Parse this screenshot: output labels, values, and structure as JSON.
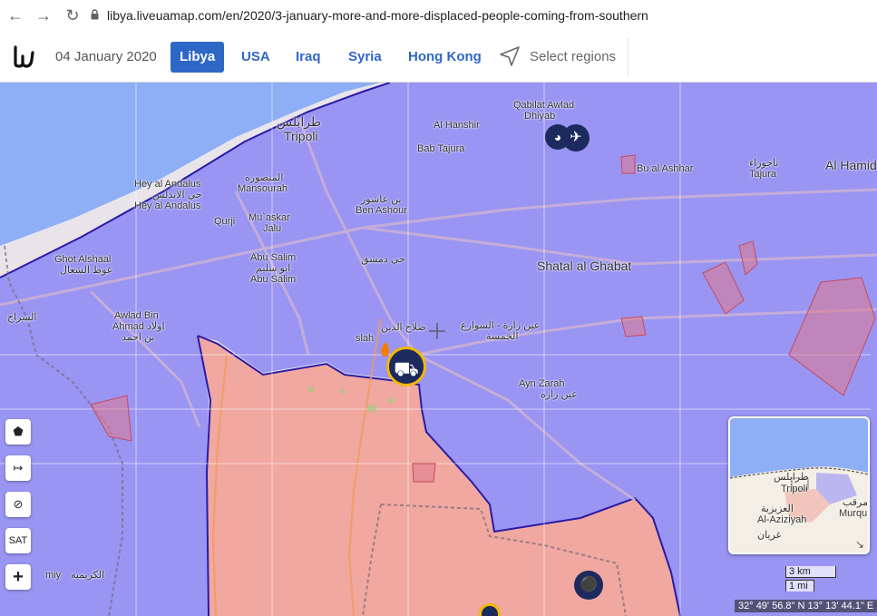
{
  "browser": {
    "url": "libya.liveuamap.com/en/2020/3-january-more-and-more-displaced-people-coming-from-southern"
  },
  "header": {
    "logo_icon": "liveuamap-logo-icon",
    "date": "04 January 2020",
    "tabs": [
      "Libya",
      "USA",
      "Iraq",
      "Syria",
      "Hong Kong"
    ],
    "active_tab": "Libya",
    "select_regions_label": "Select regions"
  },
  "map": {
    "labels": {
      "tripoli_ar": "طرابلس",
      "tripoli": "Tripoli",
      "al_hanshir": "Al Hanshir",
      "qabilat_1": "Qabilat Awlad",
      "qabilat_2": "Dhiyab",
      "bab_tajura": "Bab Tajura",
      "bu_al_ashhar": "Bu al Ashhar",
      "tajura_ar": "تاجوراء",
      "tajura": "Tajura",
      "al_hamid": "Al Hamid",
      "hey_andalus_1": "Hey al Andalus",
      "hey_andalus_ar": "حي الاندلس",
      "hey_andalus_2": "Hey al Andalus",
      "mansourah_ar": "المنصوره",
      "mansourah": "Mansourah",
      "qurji": "Qurji",
      "ben_ashour_ar": "بن عاشور",
      "ben_ashour": "Ben Ashour",
      "muaskar_1": "Mu`askar",
      "muaskar_2": "Jalu",
      "ghot_1": "Ghot Alshaal",
      "ghot_ar": "غوط الشعال",
      "abu_salim_1": "Abu Salim",
      "abu_salim_ar": "ابو سليم",
      "abu_salim_2": "Abu Salim",
      "hay_dimashq_ar": "حي دمشق",
      "shatal": "Shatal al Ghabat",
      "awlad_1": "Awlad Bin",
      "awlad_2": "Ahmad",
      "awlad_ar1": "اولاد",
      "awlad_ar2": "بن احمد",
      "alsiraj_ar": "السراج",
      "salah_1": "slah",
      "salah_ar": "صلاح الدين",
      "ain_zara_ar": "عين زارة - الشوارع",
      "ain_zara_ar2": "الخمسة",
      "ayn_zarah": "Ayn Zarah",
      "ayn_zarah_ar": "عين زاره",
      "karimiya": "miy",
      "karimiya_ar": "الكريميه"
    },
    "tools": [
      "polygon-tool-icon",
      "measure-tool-icon",
      "hide-icon",
      "SAT",
      "zoom-in-icon"
    ],
    "minimap": {
      "tripoli_ar": "طرابلس",
      "tripoli": "Tripoli",
      "aziziyah_ar": "العزيزية",
      "aziziyah": "Al-Aziziyah",
      "gharyan_ar": "غريان",
      "murq_ar": "مرقب",
      "murq": "Murqu"
    },
    "scale_km": "3 km",
    "scale_mi": "1 mi",
    "coordinates": "32° 49' 56.8\" N 13° 13' 44.1\" E",
    "colors": {
      "gna_area": "#8c87f5",
      "lna_area": "#f0a8a0",
      "sea": "#8eaef5",
      "active_tab": "#2f67c7",
      "marker": "#1d2a5e"
    }
  }
}
